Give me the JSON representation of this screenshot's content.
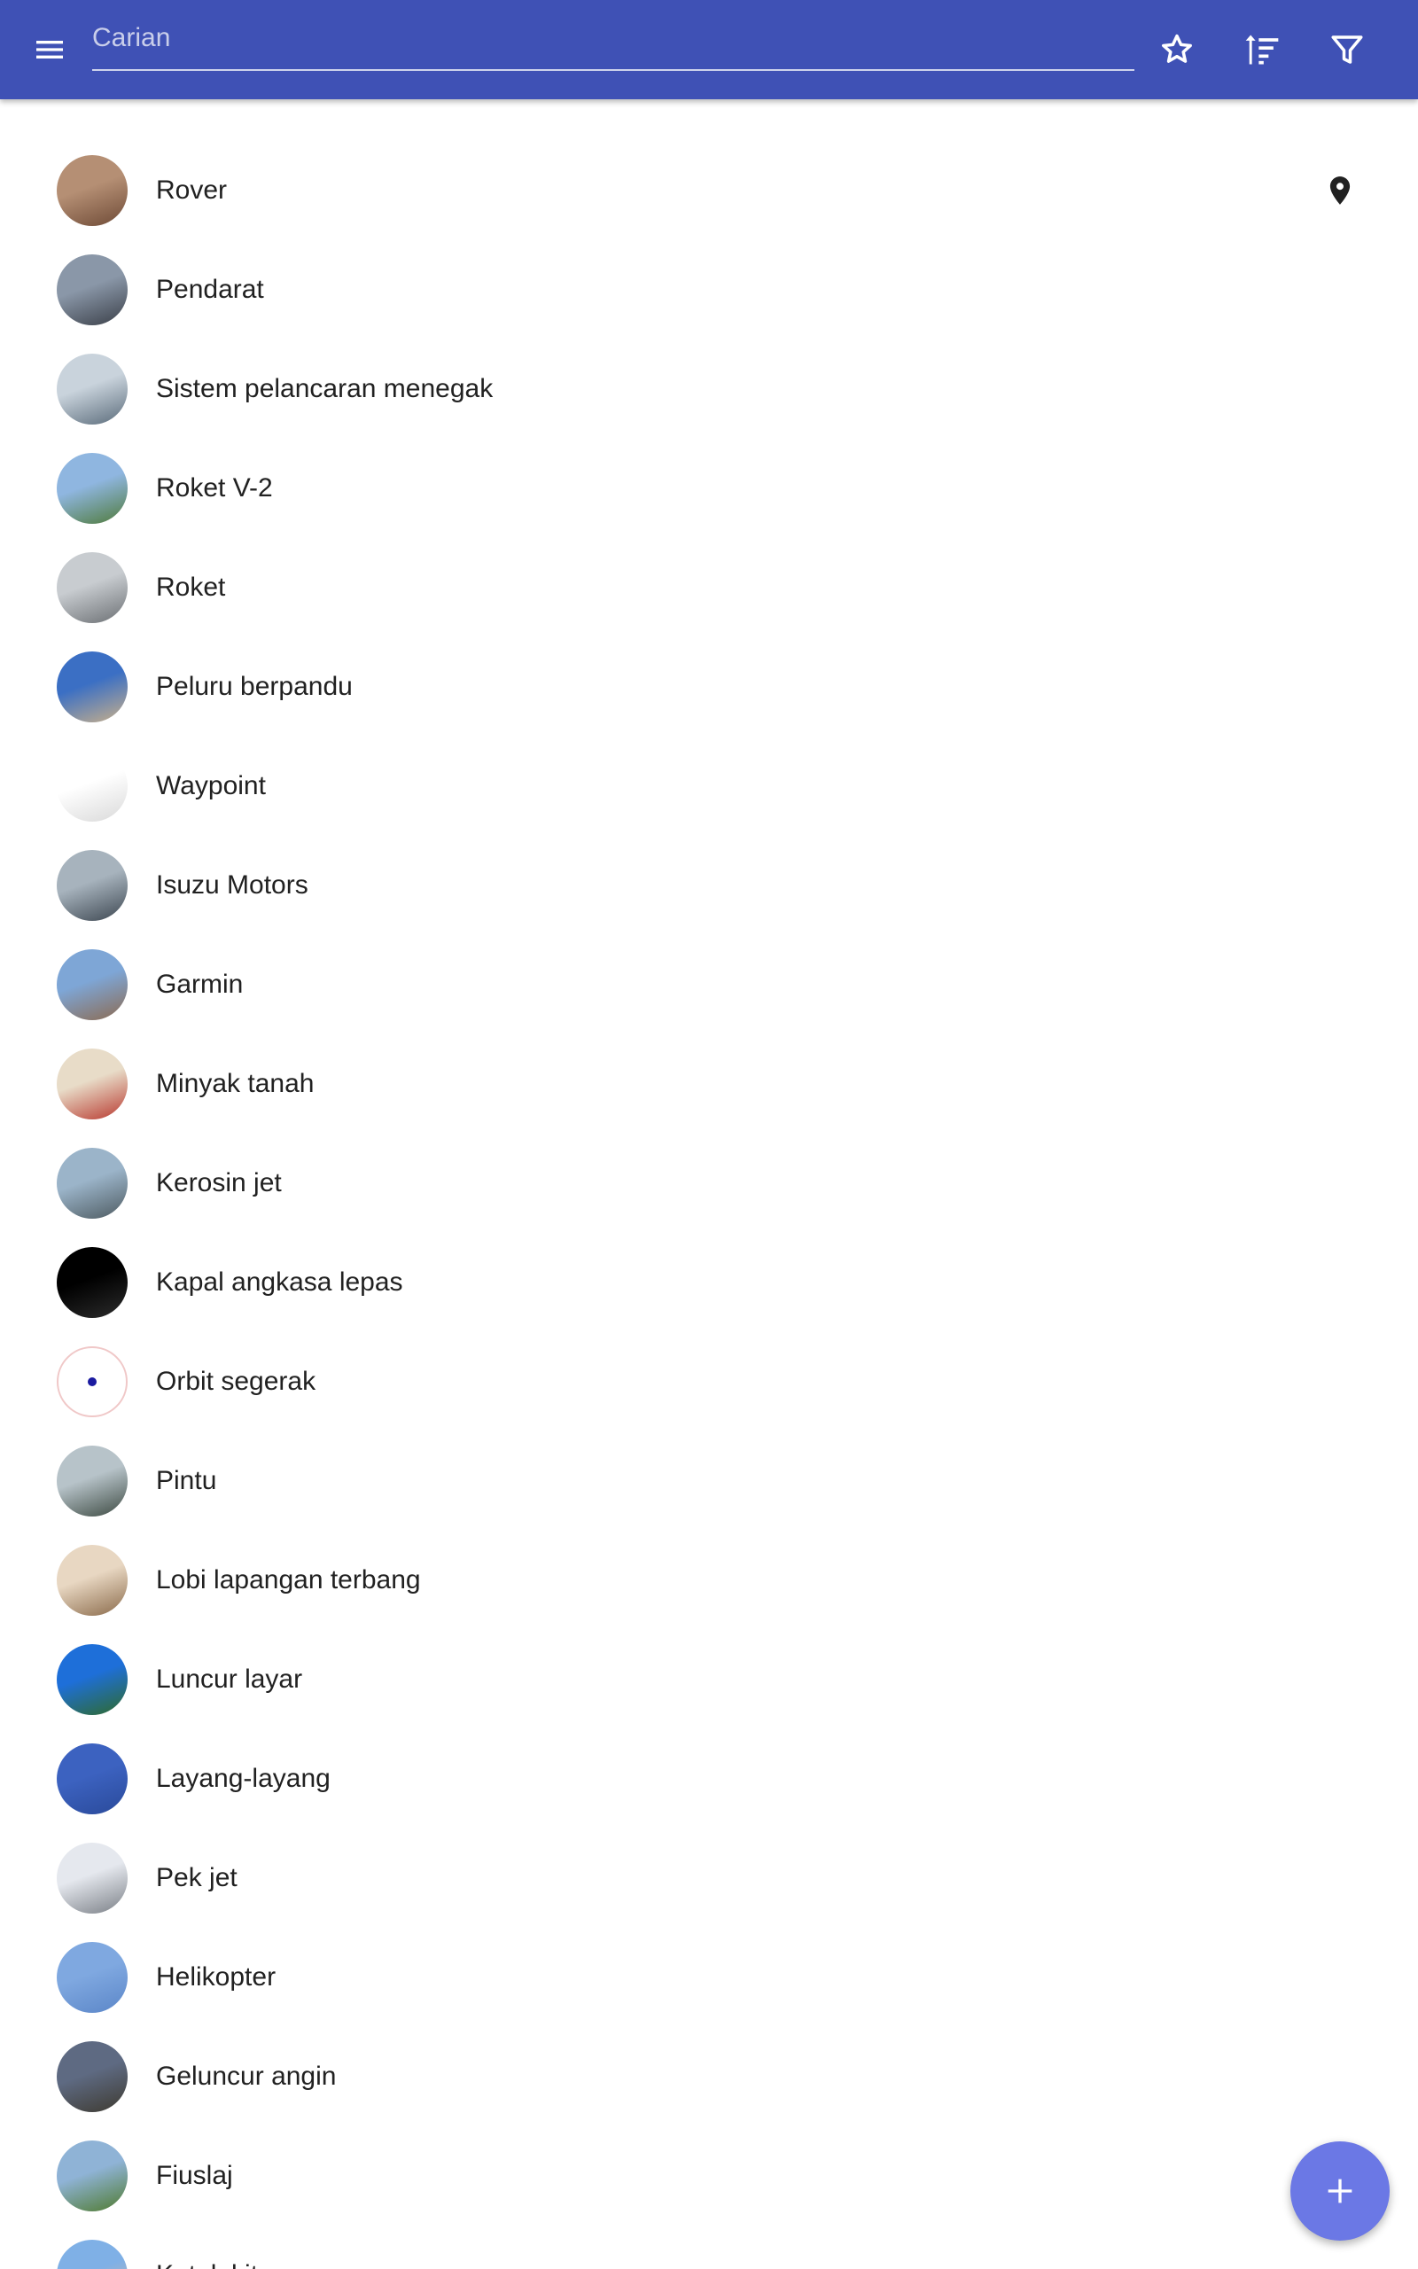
{
  "app_bar": {
    "background": "#3f51b5",
    "search_placeholder": "Carian",
    "search_value": "",
    "icons": [
      "menu-icon",
      "star-outline-icon",
      "sort-icon",
      "filter-icon"
    ]
  },
  "list": {
    "items": [
      {
        "label": "Rover",
        "avatar_colors": [
          "#b58f74",
          "#6e4a36"
        ],
        "trailing_icon": "location-pin-icon"
      },
      {
        "label": "Pendarat",
        "avatar_colors": [
          "#8a97a8",
          "#3a3f48"
        ]
      },
      {
        "label": "Sistem pelancaran menegak",
        "avatar_colors": [
          "#c9d3dc",
          "#5a6b7a"
        ]
      },
      {
        "label": "Roket V-2",
        "avatar_colors": [
          "#8fb6e0",
          "#4f7a3a"
        ]
      },
      {
        "label": "Roket",
        "avatar_colors": [
          "#c8ccd0",
          "#6b6f73"
        ]
      },
      {
        "label": "Peluru berpandu",
        "avatar_colors": [
          "#3b6fc4",
          "#c9b08a"
        ]
      },
      {
        "label": "Waypoint",
        "avatar_colors": [
          "#ffffff",
          "#d9d9d9"
        ]
      },
      {
        "label": "Isuzu Motors",
        "avatar_colors": [
          "#a7b3bd",
          "#3c4650"
        ]
      },
      {
        "label": "Garmin",
        "avatar_colors": [
          "#7ea6d6",
          "#8c6a50"
        ]
      },
      {
        "label": "Minyak tanah",
        "avatar_colors": [
          "#e8dcc8",
          "#b8382e"
        ]
      },
      {
        "label": "Kerosin jet",
        "avatar_colors": [
          "#9bb4c9",
          "#4d5a60"
        ]
      },
      {
        "label": "Kapal angkasa lepas",
        "avatar_colors": [
          "#000000",
          "#2c2c2c"
        ]
      },
      {
        "label": "Orbit segerak",
        "avatar_colors": [
          "#ffffff",
          "#ffffff"
        ]
      },
      {
        "label": "Pintu",
        "avatar_colors": [
          "#b7c3c9",
          "#3d4a42"
        ]
      },
      {
        "label": "Lobi lapangan terbang",
        "avatar_colors": [
          "#e8d7c2",
          "#8a6a4a"
        ]
      },
      {
        "label": "Luncur layar",
        "avatar_colors": [
          "#1e6fd9",
          "#2f6a2a"
        ]
      },
      {
        "label": "Layang-layang",
        "avatar_colors": [
          "#3c62c0",
          "#2a4a9a"
        ]
      },
      {
        "label": "Pek jet",
        "avatar_colors": [
          "#e5e8ee",
          "#7a7f86"
        ]
      },
      {
        "label": "Helikopter",
        "avatar_colors": [
          "#7fa8e0",
          "#5b86c8"
        ]
      },
      {
        "label": "Geluncur angin",
        "avatar_colors": [
          "#5e6a82",
          "#3e3a30"
        ]
      },
      {
        "label": "Fiuslaj",
        "avatar_colors": [
          "#8fb3d6",
          "#4f7a2e"
        ]
      },
      {
        "label": "Katak kit",
        "avatar_colors": [
          "#7fb0e6",
          "#d9b9a0"
        ]
      }
    ]
  },
  "fab": {
    "color": "#6b78e5",
    "icon": "plus-icon"
  }
}
